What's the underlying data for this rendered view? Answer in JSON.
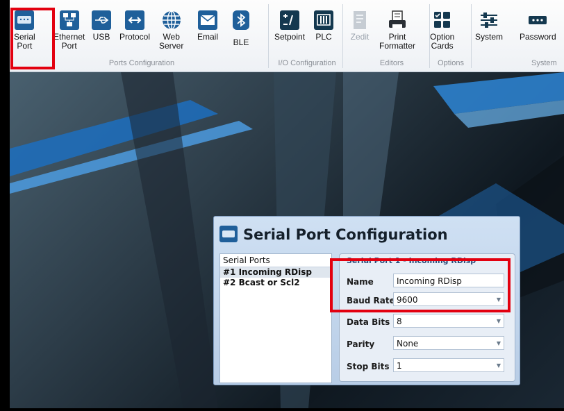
{
  "ribbon": {
    "buttons": [
      {
        "label": "Serial\nPort",
        "icon": "serial-port-icon"
      },
      {
        "label": "Ethernet\nPort",
        "icon": "ethernet-icon"
      },
      {
        "label": "USB",
        "icon": "usb-icon"
      },
      {
        "label": "Protocol",
        "icon": "protocol-icon"
      },
      {
        "label": "Web\nServer",
        "icon": "globe-icon"
      },
      {
        "label": "Email",
        "icon": "email-icon"
      },
      {
        "label": "BLE",
        "icon": "bluetooth-icon"
      },
      {
        "label": "Setpoint",
        "icon": "setpoint-icon"
      },
      {
        "label": "PLC",
        "icon": "plc-icon"
      },
      {
        "label": "Zedit",
        "icon": "zedit-icon"
      },
      {
        "label": "Print\nFormatter",
        "icon": "print-formatter-icon"
      },
      {
        "label": "Option\nCards",
        "icon": "option-cards-icon"
      },
      {
        "label": "System",
        "icon": "system-sliders-icon"
      },
      {
        "label": "Password",
        "icon": "password-icon"
      }
    ],
    "groups": [
      "Ports Configuration",
      "I/O Configuration",
      "Editors",
      "Options",
      "System"
    ]
  },
  "dialog": {
    "title": "Serial Port Configuration",
    "list_header": "Serial Ports",
    "ports": [
      "#1 Incoming RDisp",
      "#2 Bcast or Scl2"
    ],
    "panel_title": "Serial Port 1 - Incoming RDisp",
    "fields": [
      {
        "label": "Name",
        "value": "Incoming RDisp"
      },
      {
        "label": "Baud Rate",
        "value": "9600"
      },
      {
        "label": "Data Bits",
        "value": "8"
      },
      {
        "label": "Parity",
        "value": "None"
      },
      {
        "label": "Stop Bits",
        "value": "1"
      }
    ]
  },
  "colors": {
    "highlight": "#e3000f"
  }
}
